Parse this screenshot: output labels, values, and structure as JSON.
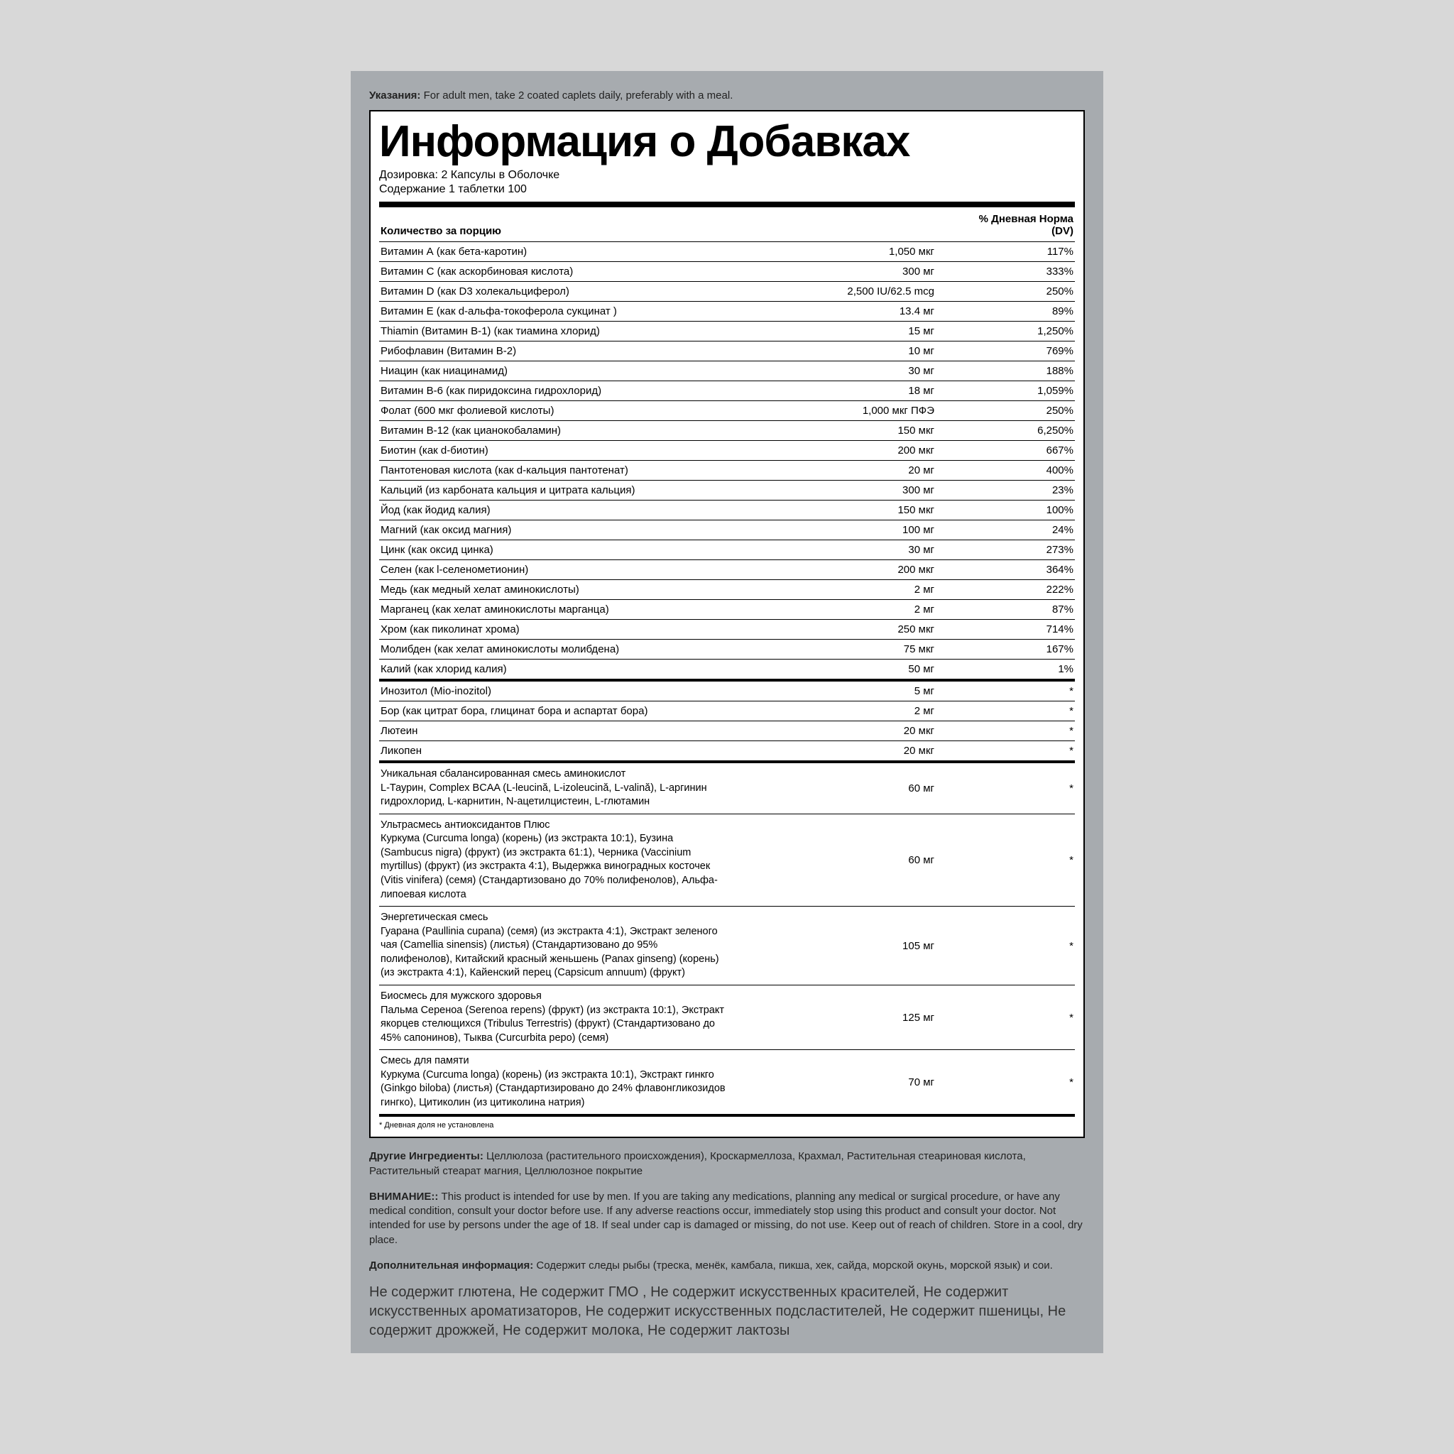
{
  "directions": {
    "label": "Указания:",
    "text": " For adult men, take 2 coated caplets daily, preferably with a meal."
  },
  "facts": {
    "title": "Информация о Добавках",
    "serving_size_label": "Дозировка:",
    "serving_size_value": " 2 Капсулы в Оболочке",
    "servings_label": "Содержание 1 таблетки",
    "servings_value": " 100",
    "header_name": "Количество за порцию",
    "header_dv1": "% Дневная Норма",
    "header_dv2": "(DV)",
    "rows": [
      {
        "name": "Витамин А (как бета-каротин)",
        "amt": "1,050 мкг",
        "dv": "117%"
      },
      {
        "name": "Витамин C (как аскорбиновая кислота)",
        "amt": "300 мг",
        "dv": "333%"
      },
      {
        "name": "Витамин D (как D3 холекальциферол)",
        "amt": "2,500 IU/62.5 mcg",
        "dv": "250%"
      },
      {
        "name": "Витамин E (как d-альфа-токоферола сукцинат )",
        "amt": "13.4 мг",
        "dv": "89%"
      },
      {
        "name": "Thiamin (Витамин B-1) (как тиамина хлорид)",
        "amt": "15 мг",
        "dv": "1,250%"
      },
      {
        "name": "Рибофлавин (Витамин B-2)",
        "amt": "10 мг",
        "dv": "769%"
      },
      {
        "name": "Ниацин (как ниацинамид)",
        "amt": "30 мг",
        "dv": "188%"
      },
      {
        "name": "Витамин B-6 (как пиридоксина гидрохлорид)",
        "amt": "18 мг",
        "dv": "1,059%"
      },
      {
        "name": "Фолат (600 мкг фолиевой кислоты)",
        "amt": "1,000 мкг ПФЭ",
        "dv": "250%"
      },
      {
        "name": "Витамин B-12 (как цианокобаламин)",
        "amt": "150 мкг",
        "dv": "6,250%"
      },
      {
        "name": "Биотин (как d-биотин)",
        "amt": "200 мкг",
        "dv": "667%"
      },
      {
        "name": "Пантотеновая кислота (как d-кальция пантотенат)",
        "amt": "20 мг",
        "dv": "400%"
      },
      {
        "name": "Кальций (из карбоната кальция и цитрата кальция)",
        "amt": "300 мг",
        "dv": "23%"
      },
      {
        "name": "Йод (как йодид калия)",
        "amt": "150 мкг",
        "dv": "100%"
      },
      {
        "name": "Магний (как оксид магния)",
        "amt": "100 мг",
        "dv": "24%"
      },
      {
        "name": "Цинк (как оксид цинка)",
        "amt": "30 мг",
        "dv": "273%"
      },
      {
        "name": "Селен (как l-селенометионин)",
        "amt": "200 мкг",
        "dv": "364%"
      },
      {
        "name": "Медь (как медный хелат аминокислоты)",
        "amt": "2 мг",
        "dv": "222%"
      },
      {
        "name": "Марганец (как хелат аминокислоты марганца)",
        "amt": "2 мг",
        "dv": "87%"
      },
      {
        "name": "Хром (как пиколинат хрома)",
        "amt": "250 мкг",
        "dv": "714%"
      },
      {
        "name": "Молибден (как хелат аминокислоты молибдена)",
        "amt": "75 мкг",
        "dv": "167%"
      },
      {
        "name": "Калий (как хлорид калия)",
        "amt": "50 мг",
        "dv": "1%",
        "section_break": true
      },
      {
        "name": "Инозитол (Mio-inozitol)",
        "amt": "5 мг",
        "dv": "*"
      },
      {
        "name": "Бор (как цитрат бора, глицинат бора и аспартат бора)",
        "amt": "2 мг",
        "dv": "*"
      },
      {
        "name": "Лютеин",
        "amt": "20 мкг",
        "dv": "*"
      },
      {
        "name": "Ликопен",
        "amt": "20 мкг",
        "dv": "*",
        "section_break": true
      },
      {
        "name": "Уникальная сбалансированная смесь аминокислот\nL-Таурин, Complex BCAA (L-leucină, L-izoleucină, L-valină), L-аргинин гидрохлорид, L-карнитин, N-ацетилцистеин, L-глютамин",
        "amt": "60 мг",
        "dv": "*",
        "blend": true
      },
      {
        "name": "Ультрасмесь антиоксидантов Плюс\nКуркума (Curcuma longa) (корень) (из экстракта 10:1), Бузина (Sambucus nigra) (фрукт) (из экстракта 61:1), Черника (Vaccinium myrtillus) (фрукт) (из экстракта 4:1), Выдержка виноградных косточек (Vitis vinifera) (семя) (Стандартизовано до 70% полифенолов), Альфа-липоевая кислота",
        "amt": "60 мг",
        "dv": "*",
        "blend": true
      },
      {
        "name": "Энергетическая смесь\nГуарана (Paullinia cupana) (семя) (из экстракта 4:1), Экстракт зеленого чая (Camellia sinensis) (листья) (Стандартизовано до 95% полифенолов), Китайский красный женьшень (Panax ginseng) (корень) (из экстракта 4:1), Кайенский перец (Capsicum annuum) (фрукт)",
        "amt": "105 мг",
        "dv": "*",
        "blend": true
      },
      {
        "name": "Биосмесь для мужского здоровья\nПальма Сереноа (Serenoa repens) (фрукт) (из экстракта 10:1), Экстракт якорцев стелющихся (Tribulus Terrestris) (фрукт) (Стандартизовано до 45% сапонинов), Тыква (Curcurbita pepo) (семя)",
        "amt": "125 мг",
        "dv": "*",
        "blend": true
      },
      {
        "name": "Смесь для памяти\nКуркума (Curcuma longa) (корень) (из экстракта 10:1), Экстракт гинкго (Ginkgo biloba) (листья) (Стандартизировано до 24% флавонгликозидов гингко), Цитиколин (из цитиколина натрия)",
        "amt": "70 мг",
        "dv": "*",
        "blend": true,
        "section_break": true
      }
    ],
    "footnote": "* Дневная доля не установлена"
  },
  "other": {
    "label": "Другие Ингредиенты:",
    "text": " Целлюлоза (растительного происхождения), Кроскармеллоза, Крахмал, Растительная стеариновая кислота, Растительный стеарат магния, Целлюлозное покрытие"
  },
  "warning": {
    "label": "ВНИМАНИЕ::",
    "text": " This product is intended for use by men. If you are taking any medications, planning any medical or surgical procedure, or have any medical condition, consult your doctor before use. If any adverse reactions occur, immediately stop using this product and consult your doctor. Not intended for use by persons under the age of 18. If seal under cap is damaged or missing, do not use. Keep out of reach of children. Store in a cool, dry place."
  },
  "extra": {
    "label": "Дополнительная информация:",
    "text": " Содержит следы рыбы (треска, менёк, камбала, пикша, хек, сайда, морской окунь, морской язык) и сои."
  },
  "claims": "Не содержит глютена, Не содержит ГМО , Не содержит искусственных красителей, Не содержит искусственных ароматизаторов, Не содержит искусственных подсластителей, Не содержит пшеницы, Не содержит дрожжей, Не содержит молока, Не содержит лактозы"
}
